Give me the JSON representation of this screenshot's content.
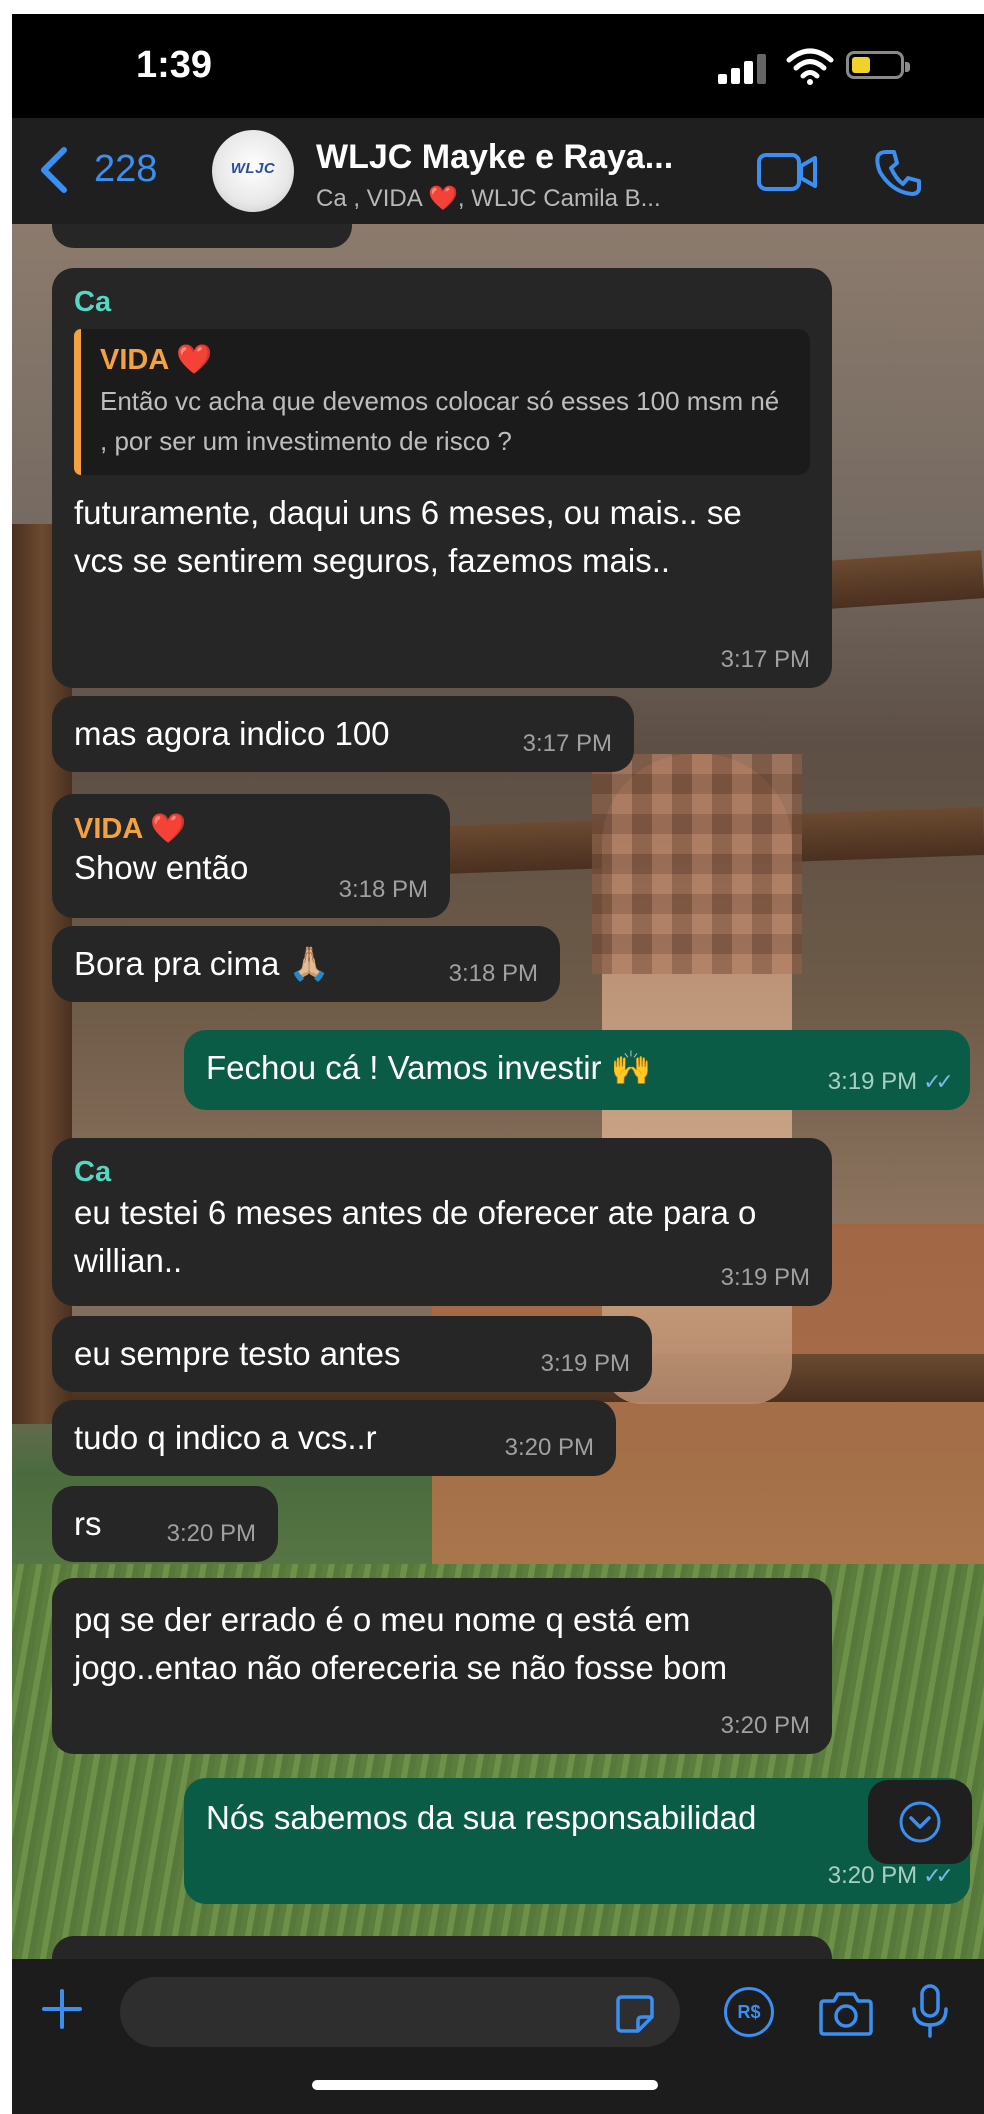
{
  "status_bar": {
    "time": "1:39",
    "battery_level": 0.4,
    "battery_color": "#f2d12b"
  },
  "header": {
    "back_count": "228",
    "avatar_text": "WLJC",
    "title": "WLJC Mayke e Raya...",
    "subtitle": "Ca , VIDA ❤️, WLJC Camila B...",
    "accent": "#3b8ff0"
  },
  "messages": [
    {
      "sender": "Ca",
      "quote": {
        "sender": "VIDA ❤️",
        "text": "Então vc acha que devemos colocar só esses 100 msm né , por ser um investimento de risco ?"
      },
      "text": "futuramente, daqui uns 6 meses, ou mais.. se vcs se sentirem seguros, fazemos mais..",
      "time": "3:17 PM"
    },
    {
      "text": "mas agora indico 100",
      "time": "3:17 PM"
    },
    {
      "sender": "VIDA ❤️",
      "text": "Show então",
      "time": "3:18 PM"
    },
    {
      "text": "Bora pra cima 🙏🏼",
      "time": "3:18 PM"
    },
    {
      "outgoing": true,
      "text": "Fechou cá ! Vamos investir 🙌",
      "time": "3:19 PM"
    },
    {
      "sender": "Ca",
      "text": "eu testei 6 meses antes de oferecer ate para o willian..",
      "time": "3:19 PM"
    },
    {
      "text": "eu sempre testo antes",
      "time": "3:19 PM"
    },
    {
      "text": "tudo q indico a vcs..r",
      "time": "3:20 PM"
    },
    {
      "text": "rs",
      "time": "3:20 PM"
    },
    {
      "text": "pq se der errado é o meu nome q está em jogo..entao não ofereceria se não fosse bom",
      "time": "3:20 PM"
    },
    {
      "outgoing": true,
      "text": "Nós sabemos da sua responsabilidad",
      "time": "3:20 PM"
    }
  ],
  "composer": {
    "placeholder": "",
    "currency_icon_label": "R$"
  },
  "colors": {
    "incoming_bubble": "#262626",
    "outgoing_bubble": "#0b5c46",
    "sender_ca": "#57d6c1",
    "sender_vida": "#f4a142"
  }
}
